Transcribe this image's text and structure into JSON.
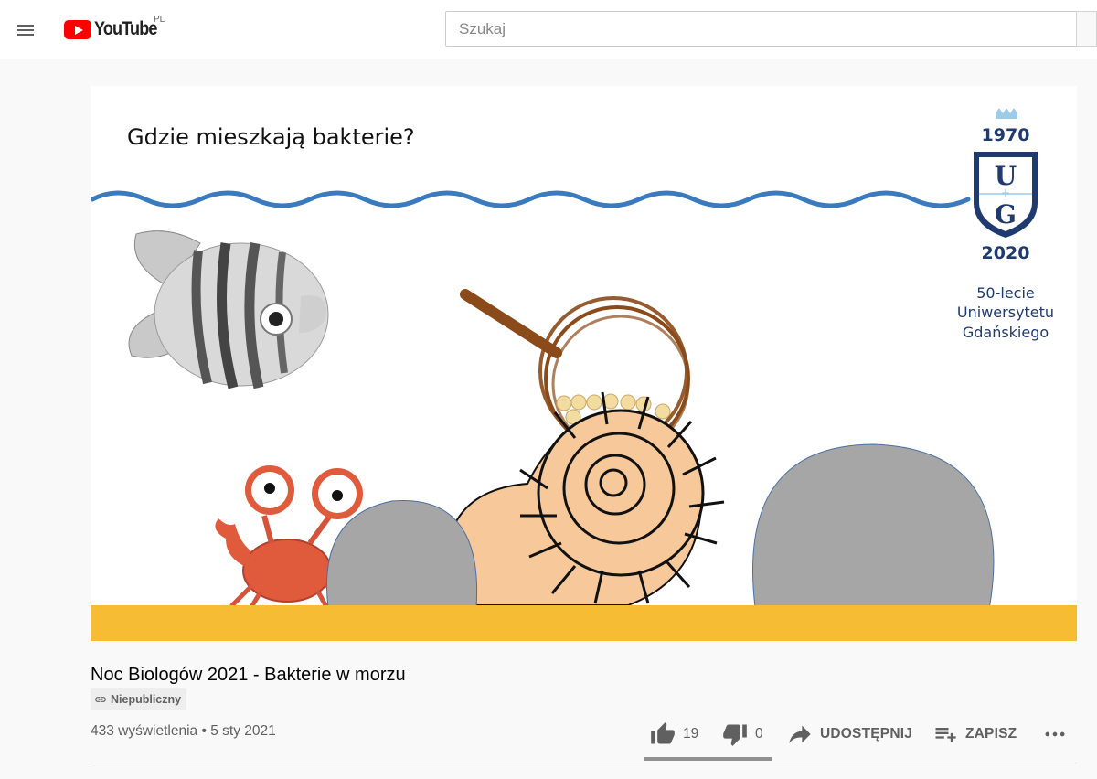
{
  "masthead": {
    "logo_text": "YouTube",
    "country_code": "PL",
    "search_placeholder": "Szukaj"
  },
  "video": {
    "slide_title": "Gdzie mieszkają bakterie?",
    "logo_year_top": "1970",
    "logo_year_bottom": "2020",
    "logo_caption_line1": "50-lecie",
    "logo_caption_line2": "Uniwersytetu",
    "logo_caption_line3": "Gdańskiego",
    "logo_letters": "UG"
  },
  "info": {
    "title": "Noc Biologów 2021 - Bakterie w morzu",
    "visibility_badge": "Niepubliczny",
    "views": "433 wyświetlenia • 5 sty 2021"
  },
  "actions": {
    "like_count": "19",
    "dislike_count": "0",
    "share_label": "UDOSTĘPNIJ",
    "save_label": "ZAPISZ",
    "like_ratio": 1.0
  },
  "colors": {
    "brand_red": "#ff0000",
    "wave_blue": "#3a7abf",
    "sand": "#f6bd34",
    "rock_gray": "#a6a6a6",
    "ug_navy": "#1f3a6e"
  }
}
